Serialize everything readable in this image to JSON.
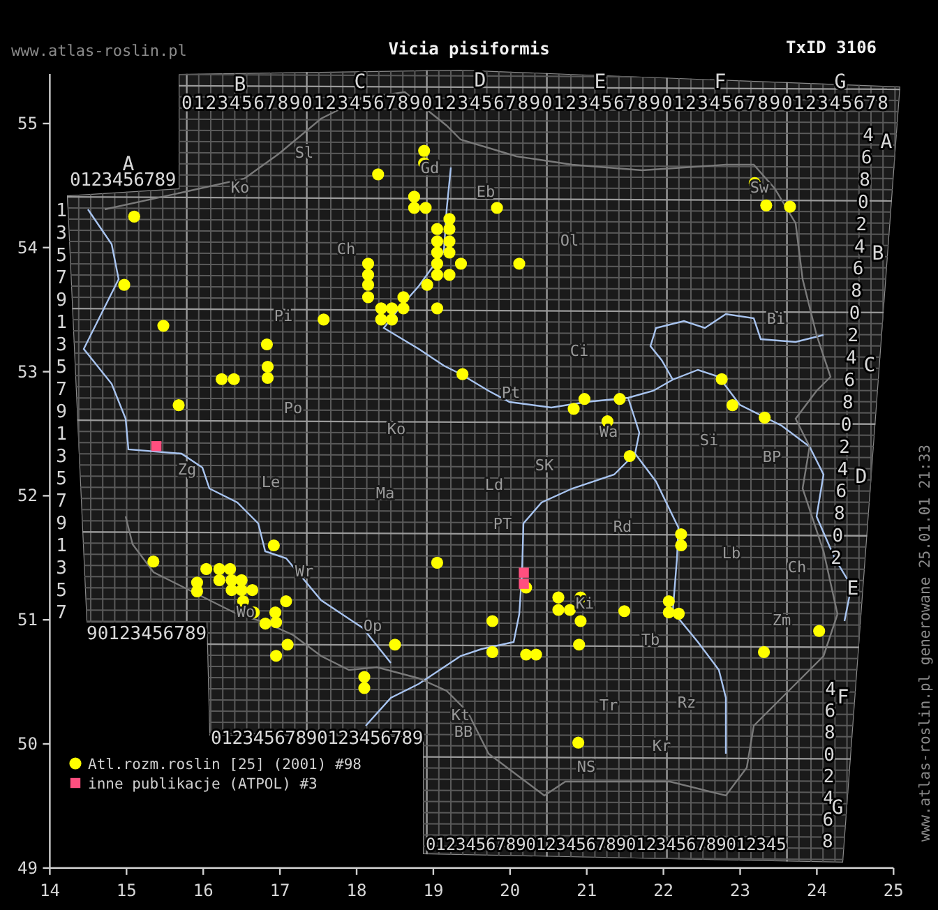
{
  "header": {
    "site": "www.atlas-roslin.pl",
    "title": "Vicia pisiformis",
    "taxon_id": "TxID 3106"
  },
  "map": {
    "chart_data": {
      "type": "scatter",
      "xlim": [
        14,
        25
      ],
      "ylim": [
        49,
        55.4
      ],
      "xticks": [
        {
          "value": 14,
          "label": "14"
        },
        {
          "value": 15,
          "label": "15"
        },
        {
          "value": 16,
          "label": "16"
        },
        {
          "value": 17,
          "label": "17"
        },
        {
          "value": 18,
          "label": "18"
        },
        {
          "value": 19,
          "label": "19"
        },
        {
          "value": 20,
          "label": "20"
        },
        {
          "value": 21,
          "label": "21"
        },
        {
          "value": 22,
          "label": "22"
        },
        {
          "value": 23,
          "label": "23"
        },
        {
          "value": 24,
          "label": "24"
        },
        {
          "value": 25,
          "label": "25"
        }
      ],
      "yticks": [
        {
          "value": 49,
          "label": "49"
        },
        {
          "value": 50,
          "label": "50"
        },
        {
          "value": 51,
          "label": "51"
        },
        {
          "value": 52,
          "label": "52"
        },
        {
          "value": 53,
          "label": "53"
        },
        {
          "value": 54,
          "label": "54"
        },
        {
          "value": 55,
          "label": "55"
        }
      ],
      "series": [
        {
          "name": "Atl.rozm.roslin [25] (2001) #98",
          "color": "#ffff00",
          "marker": "circle",
          "x": [
            18.88,
            18.88,
            18.28,
            18.75,
            18.75,
            18.9,
            19.21,
            19.05,
            19.21,
            19.05,
            19.21,
            19.05,
            19.21,
            19.05,
            19.36,
            19.05,
            19.21,
            18.92,
            19.05,
            18.15,
            18.15,
            18.15,
            18.15,
            18.32,
            18.46,
            18.61,
            18.61,
            18.32,
            18.46,
            17.57,
            16.83,
            15.48,
            15.1,
            14.97,
            19.83,
            20.12,
            23.19,
            23.34,
            23.65,
            19.38,
            16.24,
            16.4,
            16.84,
            16.84,
            15.68,
            20.97,
            20.83,
            21.43,
            21.27,
            21.56,
            22.76,
            22.9,
            23.32,
            22.23,
            22.23,
            16.92,
            15.35,
            19.05,
            16.04,
            16.21,
            16.35,
            15.92,
            15.92,
            16.21,
            16.37,
            16.5,
            16.37,
            16.5,
            16.64,
            16.52,
            16.66,
            17.08,
            16.94,
            16.81,
            16.95,
            17.1,
            16.95,
            18.5,
            18.1,
            18.1,
            20.21,
            20.63,
            20.92,
            20.63,
            20.78,
            20.92,
            21.49,
            22.07,
            22.07,
            22.2,
            19.77,
            20.9,
            19.77,
            20.21,
            20.34,
            24.03,
            23.31,
            20.89
          ],
          "values": [
            54.78,
            54.68,
            54.59,
            54.41,
            54.32,
            54.32,
            54.23,
            54.15,
            54.15,
            54.05,
            54.05,
            53.96,
            53.96,
            53.87,
            53.87,
            53.78,
            53.78,
            53.7,
            53.51,
            53.87,
            53.78,
            53.7,
            53.6,
            53.51,
            53.51,
            53.6,
            53.51,
            53.42,
            53.42,
            53.42,
            53.22,
            53.37,
            54.25,
            53.7,
            54.32,
            53.87,
            54.52,
            54.34,
            54.33,
            52.98,
            52.94,
            52.94,
            53.04,
            52.95,
            52.73,
            52.78,
            52.7,
            52.78,
            52.6,
            52.32,
            52.94,
            52.73,
            52.63,
            51.69,
            51.6,
            51.6,
            51.47,
            51.46,
            51.41,
            51.41,
            51.41,
            51.3,
            51.23,
            51.32,
            51.32,
            51.32,
            51.24,
            51.24,
            51.24,
            51.15,
            51.06,
            51.15,
            51.06,
            50.97,
            50.98,
            50.8,
            50.71,
            50.8,
            50.54,
            50.45,
            51.26,
            51.18,
            51.18,
            51.08,
            51.08,
            50.99,
            51.07,
            51.15,
            51.06,
            51.05,
            50.99,
            50.8,
            50.74,
            50.72,
            50.72,
            50.91,
            50.74,
            50.01
          ]
        },
        {
          "name": "inne publikacje (ATPOL) #3",
          "color": "#ff4f7f",
          "marker": "square",
          "x": [
            15.39,
            20.18,
            20.18
          ],
          "values": [
            52.4,
            51.38,
            51.29
          ]
        }
      ],
      "legend": true
    },
    "region_labels": [
      "Sl",
      "Gd",
      "Ko",
      "Eb",
      "Ol",
      "Sw",
      "Ch",
      "Pi",
      "Bi",
      "Ci",
      "Pt",
      "Po",
      "Wa",
      "Si",
      "Ko",
      "BP",
      "Zg",
      "Le",
      "SK",
      "Ld",
      "Ma",
      "PT",
      "Rd",
      "Lb",
      "Ch",
      "Wr",
      "Wo",
      "Op",
      "Ki",
      "Zm",
      "Tb",
      "Kt",
      "BB",
      "Tr",
      "Rz",
      "Kr",
      "NS"
    ],
    "grid_labels": {
      "column_letters": [
        "B",
        "C",
        "D",
        "E",
        "F",
        "G"
      ],
      "top_digits": "01234567890123456789012345678901234567890123456789012345678",
      "a_letter": "A",
      "a_digits": "0123456789",
      "left_digits": [
        "1",
        "3",
        "5",
        "7",
        "9",
        "1",
        "3",
        "5",
        "7",
        "9",
        "1",
        "3",
        "5",
        "7",
        "9",
        "1",
        "3",
        "5",
        "7"
      ],
      "bottom_left_digits": "90123456789",
      "lower_digits": "01234567890123456789",
      "bottom_digits": "012345678901234567890123456789012345",
      "right_digits": [
        "4",
        "6",
        "8",
        "0",
        "2",
        "4",
        "6",
        "8",
        "0",
        "2",
        "4",
        "6",
        "8",
        "0",
        "2",
        "4",
        "6",
        "8",
        "0",
        "2"
      ],
      "right_letters": [
        "A",
        "B",
        "C",
        "D",
        "E"
      ],
      "lower_right_digits": [
        "4",
        "6",
        "8",
        "0",
        "2",
        "4",
        "6",
        "8"
      ],
      "lower_right_letters": [
        "F",
        "G"
      ]
    }
  },
  "footer_note": "www.atlas-roslin.pl generowane 25.01.01 21:33"
}
